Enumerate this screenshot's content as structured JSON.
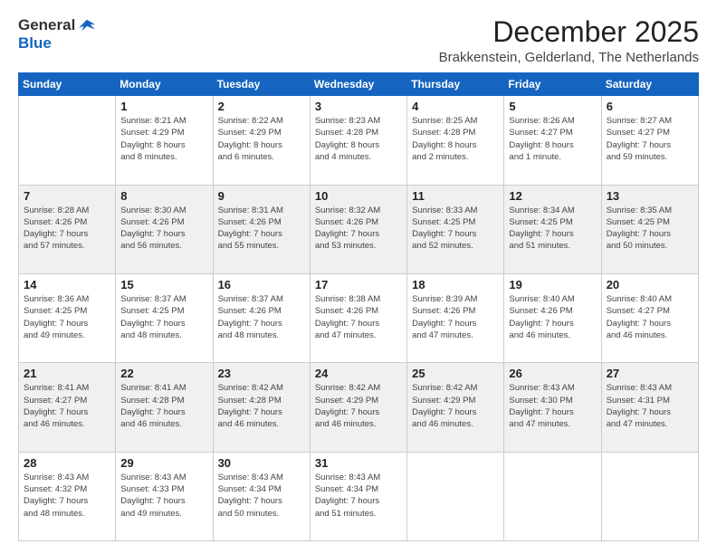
{
  "logo": {
    "general": "General",
    "blue": "Blue"
  },
  "header": {
    "month_year": "December 2025",
    "location": "Brakkenstein, Gelderland, The Netherlands"
  },
  "days_of_week": [
    "Sunday",
    "Monday",
    "Tuesday",
    "Wednesday",
    "Thursday",
    "Friday",
    "Saturday"
  ],
  "weeks": [
    [
      {
        "day": "",
        "info": ""
      },
      {
        "day": "1",
        "info": "Sunrise: 8:21 AM\nSunset: 4:29 PM\nDaylight: 8 hours\nand 8 minutes."
      },
      {
        "day": "2",
        "info": "Sunrise: 8:22 AM\nSunset: 4:29 PM\nDaylight: 8 hours\nand 6 minutes."
      },
      {
        "day": "3",
        "info": "Sunrise: 8:23 AM\nSunset: 4:28 PM\nDaylight: 8 hours\nand 4 minutes."
      },
      {
        "day": "4",
        "info": "Sunrise: 8:25 AM\nSunset: 4:28 PM\nDaylight: 8 hours\nand 2 minutes."
      },
      {
        "day": "5",
        "info": "Sunrise: 8:26 AM\nSunset: 4:27 PM\nDaylight: 8 hours\nand 1 minute."
      },
      {
        "day": "6",
        "info": "Sunrise: 8:27 AM\nSunset: 4:27 PM\nDaylight: 7 hours\nand 59 minutes."
      }
    ],
    [
      {
        "day": "7",
        "info": "Sunrise: 8:28 AM\nSunset: 4:26 PM\nDaylight: 7 hours\nand 57 minutes."
      },
      {
        "day": "8",
        "info": "Sunrise: 8:30 AM\nSunset: 4:26 PM\nDaylight: 7 hours\nand 56 minutes."
      },
      {
        "day": "9",
        "info": "Sunrise: 8:31 AM\nSunset: 4:26 PM\nDaylight: 7 hours\nand 55 minutes."
      },
      {
        "day": "10",
        "info": "Sunrise: 8:32 AM\nSunset: 4:26 PM\nDaylight: 7 hours\nand 53 minutes."
      },
      {
        "day": "11",
        "info": "Sunrise: 8:33 AM\nSunset: 4:25 PM\nDaylight: 7 hours\nand 52 minutes."
      },
      {
        "day": "12",
        "info": "Sunrise: 8:34 AM\nSunset: 4:25 PM\nDaylight: 7 hours\nand 51 minutes."
      },
      {
        "day": "13",
        "info": "Sunrise: 8:35 AM\nSunset: 4:25 PM\nDaylight: 7 hours\nand 50 minutes."
      }
    ],
    [
      {
        "day": "14",
        "info": "Sunrise: 8:36 AM\nSunset: 4:25 PM\nDaylight: 7 hours\nand 49 minutes."
      },
      {
        "day": "15",
        "info": "Sunrise: 8:37 AM\nSunset: 4:25 PM\nDaylight: 7 hours\nand 48 minutes."
      },
      {
        "day": "16",
        "info": "Sunrise: 8:37 AM\nSunset: 4:26 PM\nDaylight: 7 hours\nand 48 minutes."
      },
      {
        "day": "17",
        "info": "Sunrise: 8:38 AM\nSunset: 4:26 PM\nDaylight: 7 hours\nand 47 minutes."
      },
      {
        "day": "18",
        "info": "Sunrise: 8:39 AM\nSunset: 4:26 PM\nDaylight: 7 hours\nand 47 minutes."
      },
      {
        "day": "19",
        "info": "Sunrise: 8:40 AM\nSunset: 4:26 PM\nDaylight: 7 hours\nand 46 minutes."
      },
      {
        "day": "20",
        "info": "Sunrise: 8:40 AM\nSunset: 4:27 PM\nDaylight: 7 hours\nand 46 minutes."
      }
    ],
    [
      {
        "day": "21",
        "info": "Sunrise: 8:41 AM\nSunset: 4:27 PM\nDaylight: 7 hours\nand 46 minutes."
      },
      {
        "day": "22",
        "info": "Sunrise: 8:41 AM\nSunset: 4:28 PM\nDaylight: 7 hours\nand 46 minutes."
      },
      {
        "day": "23",
        "info": "Sunrise: 8:42 AM\nSunset: 4:28 PM\nDaylight: 7 hours\nand 46 minutes."
      },
      {
        "day": "24",
        "info": "Sunrise: 8:42 AM\nSunset: 4:29 PM\nDaylight: 7 hours\nand 46 minutes."
      },
      {
        "day": "25",
        "info": "Sunrise: 8:42 AM\nSunset: 4:29 PM\nDaylight: 7 hours\nand 46 minutes."
      },
      {
        "day": "26",
        "info": "Sunrise: 8:43 AM\nSunset: 4:30 PM\nDaylight: 7 hours\nand 47 minutes."
      },
      {
        "day": "27",
        "info": "Sunrise: 8:43 AM\nSunset: 4:31 PM\nDaylight: 7 hours\nand 47 minutes."
      }
    ],
    [
      {
        "day": "28",
        "info": "Sunrise: 8:43 AM\nSunset: 4:32 PM\nDaylight: 7 hours\nand 48 minutes."
      },
      {
        "day": "29",
        "info": "Sunrise: 8:43 AM\nSunset: 4:33 PM\nDaylight: 7 hours\nand 49 minutes."
      },
      {
        "day": "30",
        "info": "Sunrise: 8:43 AM\nSunset: 4:34 PM\nDaylight: 7 hours\nand 50 minutes."
      },
      {
        "day": "31",
        "info": "Sunrise: 8:43 AM\nSunset: 4:34 PM\nDaylight: 7 hours\nand 51 minutes."
      },
      {
        "day": "",
        "info": ""
      },
      {
        "day": "",
        "info": ""
      },
      {
        "day": "",
        "info": ""
      }
    ]
  ]
}
